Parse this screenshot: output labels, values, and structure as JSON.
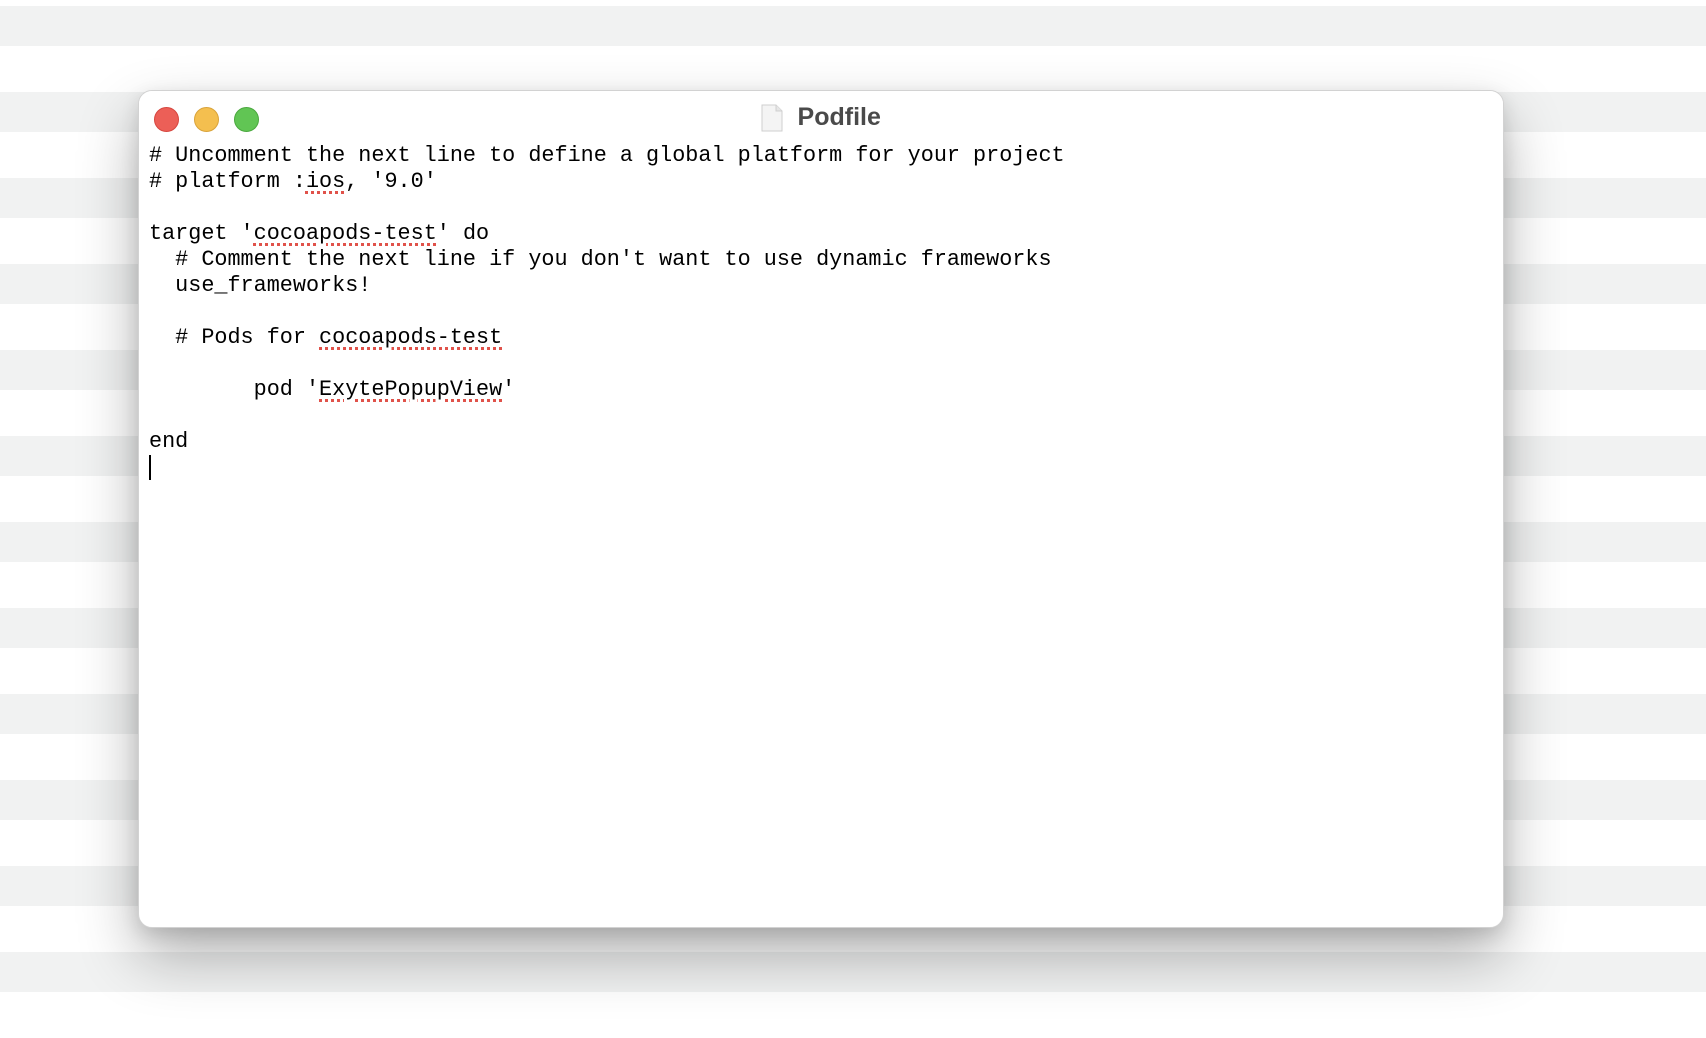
{
  "window": {
    "title": "Podfile",
    "buttons": {
      "close": "close-window",
      "minimize": "minimize-window",
      "zoom": "zoom-window"
    }
  },
  "editor": {
    "lines": [
      [
        "# Uncomment the next line to define a global platform for your project"
      ],
      [
        "# platform :",
        "ios",
        ", '9.0'"
      ],
      [
        ""
      ],
      [
        "target '",
        "cocoapods-test",
        "' do"
      ],
      [
        "  # Comment the next line if you don't want to use dynamic frameworks"
      ],
      [
        "  use_frameworks!"
      ],
      [
        ""
      ],
      [
        "  # Pods for ",
        "cocoapods-test"
      ],
      [
        ""
      ],
      [
        "        pod '",
        "ExytePopupView",
        "'"
      ],
      [
        ""
      ],
      [
        "end"
      ]
    ]
  },
  "colors": {
    "close": "#ec5f57",
    "minimize": "#f4bf4f",
    "zoom": "#61c554",
    "spellcheck_underline": "#e0524a"
  }
}
